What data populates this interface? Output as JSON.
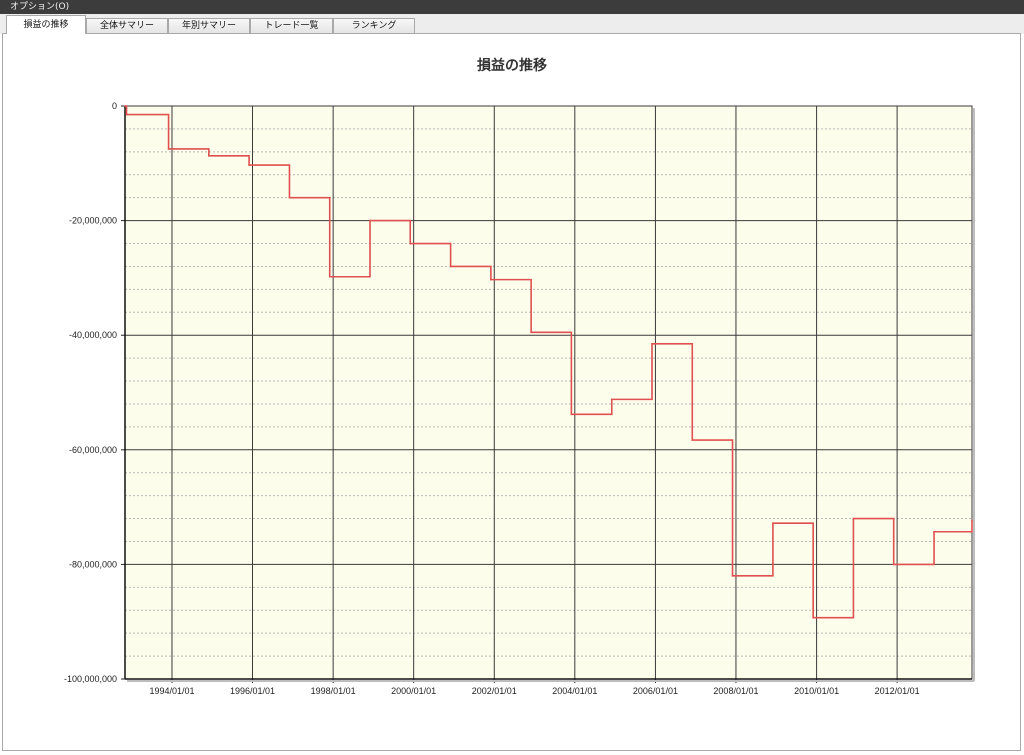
{
  "menu": {
    "options_label": "オプション(O)"
  },
  "tabs": [
    {
      "label": "損益の推移",
      "active": true
    },
    {
      "label": "全体サマリー",
      "active": false
    },
    {
      "label": "年別サマリー",
      "active": false
    },
    {
      "label": "トレード一覧",
      "active": false
    },
    {
      "label": "ランキング",
      "active": false
    }
  ],
  "colors": {
    "plot_background": "#fdfdeb",
    "series_line": "#e05050",
    "major_grid": "#3a3a3a",
    "minor_grid": "#b8b8b8"
  },
  "chart_data": {
    "type": "line",
    "title": "損益の推移",
    "xlabel": "",
    "ylabel": "",
    "grid": true,
    "legend": "none",
    "xlim": [
      "1992/11/01",
      "2013/11/10"
    ],
    "ylim": [
      -100000000,
      0
    ],
    "yticks": [
      0,
      -20000000,
      -40000000,
      -60000000,
      -80000000,
      -100000000
    ],
    "ytick_labels": [
      "0",
      "-20,000,000",
      "-40,000,000",
      "-60,000,000",
      "-80,000,000",
      "-100,000,000"
    ],
    "xticks": [
      "1994/01/01",
      "1996/01/01",
      "1998/01/01",
      "2000/01/01",
      "2002/01/01",
      "2004/01/01",
      "2006/01/01",
      "2008/01/01",
      "2010/01/01",
      "2012/01/01"
    ],
    "series": [
      {
        "step": true,
        "points": [
          [
            "1992/11/01",
            0
          ],
          [
            "1992/11/15",
            -1500000
          ],
          [
            "1993/12/01",
            -7500000
          ],
          [
            "1994/12/01",
            -8700000
          ],
          [
            "1995/12/01",
            -10300000
          ],
          [
            "1996/12/01",
            -16000000
          ],
          [
            "1997/12/01",
            -29800000
          ],
          [
            "1998/12/01",
            -20000000
          ],
          [
            "1999/12/01",
            -24000000
          ],
          [
            "2000/12/01",
            -28000000
          ],
          [
            "2001/12/01",
            -30300000
          ],
          [
            "2002/12/01",
            -39500000
          ],
          [
            "2003/12/01",
            -53800000
          ],
          [
            "2004/12/01",
            -51200000
          ],
          [
            "2005/12/01",
            -41500000
          ],
          [
            "2006/12/01",
            -58300000
          ],
          [
            "2007/12/01",
            -82000000
          ],
          [
            "2008/12/01",
            -72800000
          ],
          [
            "2009/12/01",
            -89300000
          ],
          [
            "2010/12/01",
            -72000000
          ],
          [
            "2011/12/01",
            -80000000
          ],
          [
            "2012/12/01",
            -74300000
          ],
          [
            "2013/11/10",
            -72300000
          ]
        ]
      }
    ]
  }
}
